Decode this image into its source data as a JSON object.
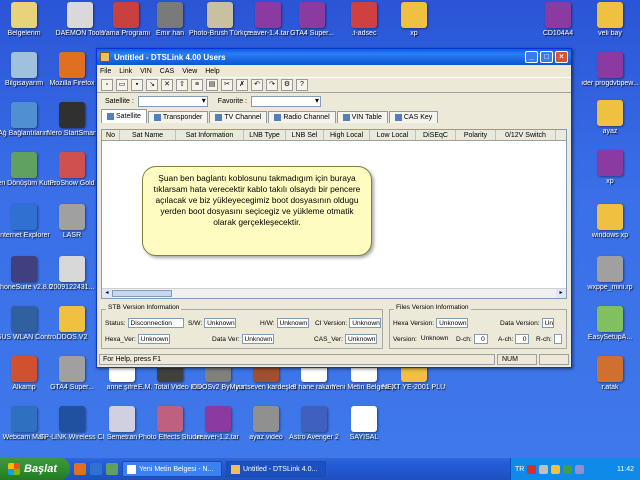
{
  "desktop_icons": [
    {
      "id": "belgelerim",
      "label": "Belgelerim",
      "color": "#e8d27a"
    },
    {
      "id": "daemon",
      "label": "DAEMON Tools",
      "color": "#d9d9d9"
    },
    {
      "id": "yama",
      "label": "Yama Programı",
      "color": "#c94040"
    },
    {
      "id": "emirhan",
      "label": "Emir han",
      "color": "#7a7a7a"
    },
    {
      "id": "photobrush",
      "label": "Photo-Brush Türkçe",
      "color": "#c8c0a0"
    },
    {
      "id": "reaver14",
      "label": "reaver-1.4.tar",
      "color": "#8a3aa0"
    },
    {
      "id": "gta4super1",
      "label": "GTA4 Super...",
      "color": "#8a3aa0"
    },
    {
      "id": "tadsec",
      "label": ".t-adsec",
      "color": "#d04040"
    },
    {
      "id": "xp1",
      "label": "xp",
      "color": "#f0c040"
    },
    {
      "id": "cd104a4",
      "label": "CD104A4",
      "color": "#8a3aa0"
    },
    {
      "id": "velibey",
      "label": "veli bay",
      "color": "#f0c040"
    },
    {
      "id": "bilgisayarim",
      "label": "Bilgisayarım",
      "color": "#a0c0e0"
    },
    {
      "id": "firefox",
      "label": "Mozilla Firefox",
      "color": "#e07020"
    },
    {
      "id": "nero",
      "label": "Nero StartSmart",
      "color": "#303030"
    },
    {
      "id": "agbaglanti",
      "label": "Ağ Bağlantılarım",
      "color": "#5090d0"
    },
    {
      "id": "gendonusum",
      "label": "Geri Dönüşüm Kutusu",
      "color": "#60a060"
    },
    {
      "id": "proshow",
      "label": "ProShow Gold",
      "color": "#d05050"
    },
    {
      "id": "ie",
      "label": "Internet Explorer",
      "color": "#3070d0"
    },
    {
      "id": "lasr",
      "label": "LASR",
      "color": "#a0a0a0"
    },
    {
      "id": "phonesuite",
      "label": "PhoneSuite v2.8.0",
      "color": "#404080"
    },
    {
      "id": "jpg2009",
      "label": "2009122431...",
      "color": "#d8d8d8"
    },
    {
      "id": "asus",
      "label": "ASUS WLAN Control Center",
      "color": "#3060a0"
    },
    {
      "id": "ddos",
      "label": "DDOS.V2",
      "color": "#f0c040"
    },
    {
      "id": "alkamp",
      "label": "Alkamp",
      "color": "#d05030"
    },
    {
      "id": "gta4super2",
      "label": "GTA4 Super...",
      "color": "#a0a0a0"
    },
    {
      "id": "anne",
      "label": "anne şifre",
      "color": "#ffffff"
    },
    {
      "id": "emtotal",
      "label": "E.M. Total Video Player",
      "color": "#404040"
    },
    {
      "id": "ddosv2",
      "label": "DDOSv2 ByMiss",
      "color": "#808080"
    },
    {
      "id": "yurtseven",
      "label": "yurtseven kardeşler",
      "color": "#a05030"
    },
    {
      "id": "8hane",
      "label": "8 hane rakam",
      "color": "#ffffff"
    },
    {
      "id": "yenimetin",
      "label": "Yeni Metin Belgesi (2)",
      "color": "#ffffff"
    },
    {
      "id": "nextye",
      "label": "NEXT YE-2001 PLUS (DA)F...",
      "color": "#f0c040"
    },
    {
      "id": "rotak",
      "label": "r.atak",
      "color": "#d07030"
    },
    {
      "id": "webcam",
      "label": "Webcam Max",
      "color": "#3070c0"
    },
    {
      "id": "tplink",
      "label": "TP-LINK Wireless Cli...",
      "color": "#2050a0"
    },
    {
      "id": "semetran",
      "label": "Semetran",
      "color": "#d0d0e0"
    },
    {
      "id": "photoeffects",
      "label": "Photo Effects Studio",
      "color": "#c06080"
    },
    {
      "id": "reaver12",
      "label": "reaver-1.2.tar",
      "color": "#8a3aa0"
    },
    {
      "id": "ayazvideo",
      "label": "ayaz video",
      "color": "#909090"
    },
    {
      "id": "astro",
      "label": "Astro Avenger 2",
      "color": "#4060c0"
    },
    {
      "id": "sayisal",
      "label": "SAYISAL",
      "color": "#ffffff"
    },
    {
      "id": "ayaz",
      "label": "ayaz",
      "color": "#f0c040"
    },
    {
      "id": "xp2",
      "label": "xp",
      "color": "#8a3aa0"
    },
    {
      "id": "windowsxp",
      "label": "windows xp",
      "color": "#f0c040"
    },
    {
      "id": "wxppe",
      "label": "wxppe_mini.rp",
      "color": "#a0a0a0"
    },
    {
      "id": "easysetup",
      "label": "EasySetupA...",
      "color": "#80c060"
    },
    {
      "id": "progdrv",
      "label": "ıder progdvbpew...",
      "color": "#8a3aa0"
    }
  ],
  "window": {
    "title": "Untitled - DTSLink 4.00 Users",
    "menu": [
      "File",
      "Link",
      "VIN",
      "CAS",
      "View",
      "Help"
    ],
    "satellite_label": "Satellite :",
    "favorite_label": "Favorite :",
    "tabs": [
      {
        "label": "Satellite",
        "active": true
      },
      {
        "label": "Transponder",
        "active": false
      },
      {
        "label": "TV Channel",
        "active": false
      },
      {
        "label": "Radio Channel",
        "active": false
      },
      {
        "label": "VIN Table",
        "active": false
      },
      {
        "label": "CAS Key",
        "active": false
      }
    ],
    "columns": [
      "No",
      "Sat Name",
      "Sat Information",
      "LNB Type",
      "LNB Sel",
      "High Local",
      "Low Local",
      "DiSEqC",
      "Polarity",
      "0/12V Switch"
    ],
    "callout_text": "Şuan ben baglantı koblosunu takmadıgım için buraya tıklarsam hata verecektir  kablo takılı olsaydı bir pencere açılacak ve  biz yükleyecegimiz boot dosyasının oldugu yerden boot dosyasını seçicegiz  ve yükleme otmatik olarak gerçekleşecektir.",
    "stb": {
      "title": "STB Version Information",
      "status_label": "Status:",
      "status_value": "Disconnection",
      "sw_label": "S/W:",
      "sw_value": "Unknown",
      "hw_label": "H/W:",
      "hw_value": "Unknown",
      "ci_label": "CI Version:",
      "ci_value": "Unknown",
      "hexa_label": "Hexa_Ver:",
      "hexa_value": "Unknown",
      "data_label": "Data Ver:",
      "data_value": "Unknown",
      "cas_label": "CAS_Ver:",
      "cas_value": "Unknown"
    },
    "files": {
      "title": "Files Version Information",
      "hexa_label": "Hexa Version:",
      "hexa_value": "Unknown",
      "data_label": "Data Version:",
      "data_value": "Unknown",
      "version_label": "Version:",
      "version_value": "Unknown",
      "dch_label": "D-ch:",
      "dch_value": "0",
      "ach_label": "A-ch:",
      "ach_value": "0",
      "rch_label": "R-ch:",
      "rch_value": ""
    },
    "status_text": "For Help, press F1",
    "status_num": "NUM"
  },
  "taskbar": {
    "start_label": "Başlat",
    "tasks": [
      {
        "label": "Yeni Metin Belgesi - N...",
        "active": false
      },
      {
        "label": "Untitled - DTSLink 4.0...",
        "active": true
      }
    ],
    "tray_lang": "TR",
    "clock": "11:42"
  },
  "colors": {
    "desktop": "#3a6fe8",
    "titlebar": "#0a5fdd",
    "callout_bg": "#fffcc2",
    "start_green": "#2d8a2d"
  }
}
